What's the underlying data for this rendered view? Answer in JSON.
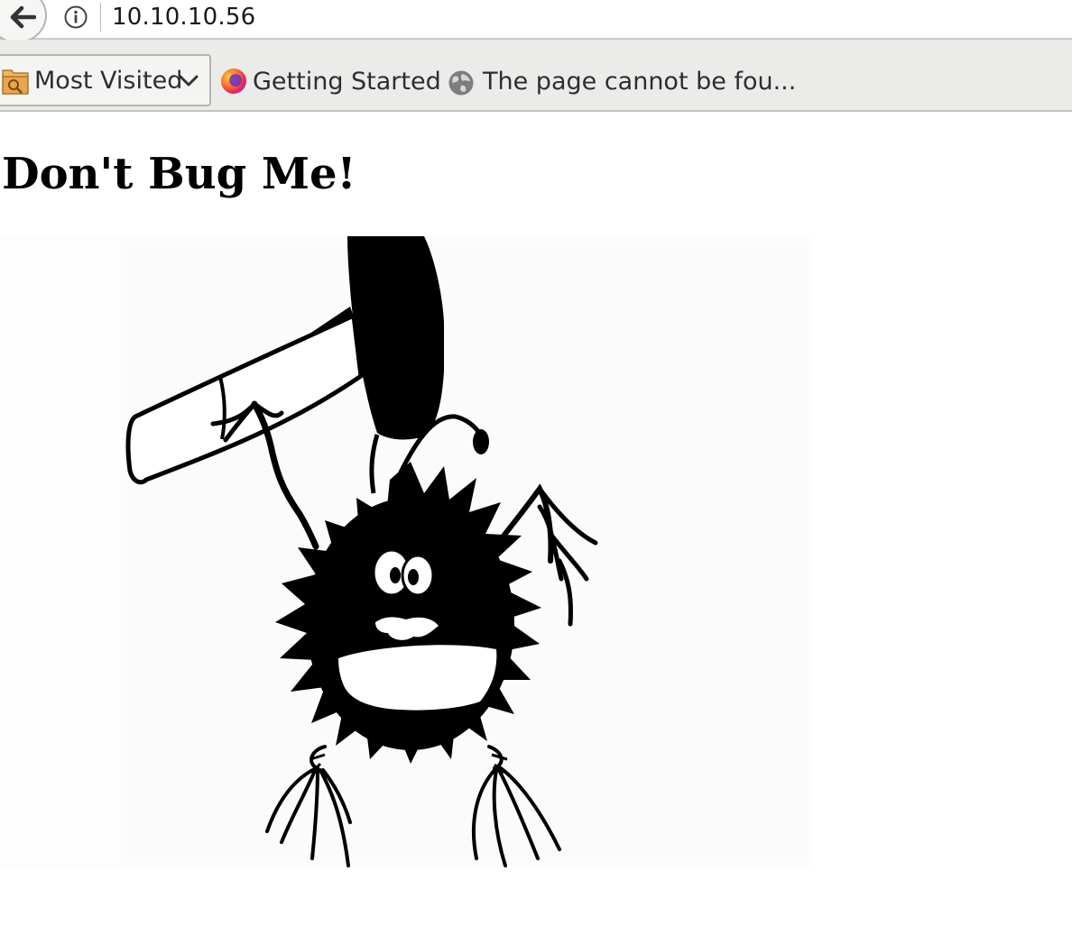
{
  "browser": {
    "url": "10.10.10.56",
    "back_icon": "back-arrow-icon",
    "info_icon": "info-icon"
  },
  "bookmarks": {
    "most_visited": "Most Visited",
    "getting_started": "Getting Started",
    "page_not_found": "The page cannot be fou..."
  },
  "page": {
    "heading": "Don't Bug Me!",
    "image_subject": "cartoon-bug-with-hammer"
  }
}
